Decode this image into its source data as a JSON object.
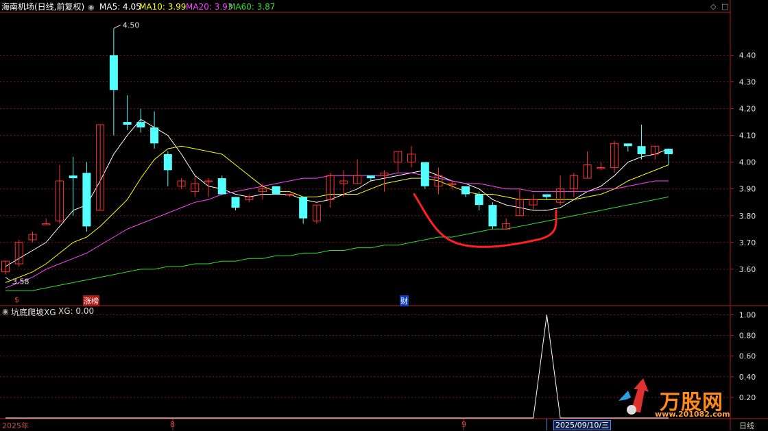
{
  "header": {
    "stock_title": "海南机场(日线,前复权)",
    "ma": [
      {
        "label": "MA5: 4.05",
        "color": "#ffffff"
      },
      {
        "label": "MA10: 3.99",
        "color": "#ffff00"
      },
      {
        "label": "MA20: 3.93",
        "color": "#ff44ff"
      },
      {
        "label": "MA60: 3.87",
        "color": "#33dd33"
      }
    ],
    "settings_icon": "chevron-down-icon",
    "window_controls": [
      "◇",
      "□"
    ]
  },
  "indicator": {
    "title": "坑底爬坡XG",
    "value_label": "XG: 0.00",
    "y_ticks": [
      "1.00",
      "0.80",
      "0.60",
      "0.40",
      "0.20"
    ]
  },
  "footer": {
    "period_labels": [
      "2025年",
      "8",
      "9"
    ],
    "selected_date": "2025/09/10/三",
    "timeframe": "日线"
  },
  "event_markers": [
    {
      "label": "$",
      "color": "#e04040"
    },
    {
      "label": "涨榜",
      "color": "#ffffff",
      "bg": "#b01818"
    },
    {
      "label": "财",
      "color": "#ffffff",
      "bg": "#1040c0"
    }
  ],
  "watermark": {
    "brand": "万股网",
    "url": "www.201082.com"
  },
  "chart_data": {
    "type": "candlestick",
    "price_axis": {
      "ticks": [
        "4.40",
        "4.30",
        "4.20",
        "4.10",
        "4.00",
        "3.90",
        "3.80",
        "3.70",
        "3.60"
      ],
      "ylim": [
        3.51,
        4.56
      ]
    },
    "annotations": {
      "high": "4.50",
      "low": "3.58"
    },
    "up_color": "#ff3232",
    "down_color": "#54ffff",
    "candles": [
      [
        3.59,
        3.63,
        3.63,
        3.58
      ],
      [
        3.62,
        3.7,
        3.71,
        3.61
      ],
      [
        3.71,
        3.73,
        3.74,
        3.7
      ],
      [
        3.77,
        3.77,
        3.79,
        3.77
      ],
      [
        3.78,
        3.93,
        3.99,
        3.77
      ],
      [
        3.95,
        3.94,
        4.02,
        3.8
      ],
      [
        3.96,
        3.76,
        4.0,
        3.74
      ],
      [
        3.82,
        4.14,
        4.14,
        3.82
      ],
      [
        4.4,
        4.27,
        4.5,
        4.1
      ],
      [
        4.15,
        4.14,
        4.25,
        4.12
      ],
      [
        4.15,
        4.13,
        4.2,
        4.11
      ],
      [
        4.13,
        4.07,
        4.19,
        4.05
      ],
      [
        4.03,
        3.97,
        4.04,
        3.91
      ],
      [
        3.91,
        3.93,
        3.94,
        3.9
      ],
      [
        3.89,
        3.92,
        3.95,
        3.87
      ],
      [
        3.93,
        3.93,
        3.94,
        3.87
      ],
      [
        3.94,
        3.88,
        3.95,
        3.88
      ],
      [
        3.87,
        3.83,
        3.87,
        3.82
      ],
      [
        3.86,
        3.87,
        3.88,
        3.85
      ],
      [
        3.89,
        3.9,
        3.92,
        3.86
      ],
      [
        3.91,
        3.88,
        3.91,
        3.88
      ],
      [
        3.88,
        3.88,
        3.88,
        3.87
      ],
      [
        3.87,
        3.79,
        3.87,
        3.77
      ],
      [
        3.78,
        3.84,
        3.84,
        3.77
      ],
      [
        3.86,
        3.95,
        3.96,
        3.83
      ],
      [
        3.92,
        3.93,
        3.97,
        3.87
      ],
      [
        3.92,
        3.95,
        4.01,
        3.92
      ],
      [
        3.95,
        3.94,
        3.95,
        3.93
      ],
      [
        3.95,
        3.96,
        3.97,
        3.89
      ],
      [
        4.0,
        4.04,
        4.04,
        3.96
      ],
      [
        4.0,
        4.03,
        4.06,
        3.98
      ],
      [
        4.0,
        3.91,
        4.0,
        3.9
      ],
      [
        3.91,
        3.95,
        3.98,
        3.88
      ],
      [
        3.92,
        3.92,
        3.93,
        3.9
      ],
      [
        3.91,
        3.88,
        3.91,
        3.87
      ],
      [
        3.88,
        3.84,
        3.89,
        3.82
      ],
      [
        3.84,
        3.76,
        3.85,
        3.75
      ],
      [
        3.75,
        3.77,
        3.79,
        3.75
      ],
      [
        3.8,
        3.86,
        3.9,
        3.8
      ],
      [
        3.84,
        3.86,
        3.88,
        3.82
      ],
      [
        3.88,
        3.87,
        3.88,
        3.86
      ],
      [
        3.85,
        3.9,
        3.95,
        3.84
      ],
      [
        3.9,
        3.95,
        3.96,
        3.87
      ],
      [
        3.94,
        3.99,
        4.04,
        3.94
      ],
      [
        3.98,
        3.98,
        4.0,
        3.97
      ],
      [
        3.98,
        4.07,
        4.08,
        3.96
      ],
      [
        4.07,
        4.06,
        4.07,
        4.04
      ],
      [
        4.06,
        4.03,
        4.14,
        4.01
      ],
      [
        4.03,
        4.06,
        4.06,
        4.01
      ],
      [
        4.05,
        4.03,
        4.05,
        3.99
      ]
    ],
    "ma_series": [
      {
        "name": "MA5",
        "color": "#ffffff",
        "values": [
          3.61,
          3.64,
          3.67,
          3.7,
          3.76,
          3.82,
          3.84,
          3.93,
          4.03,
          4.1,
          4.16,
          4.13,
          4.1,
          4.03,
          3.95,
          3.91,
          3.9,
          3.88,
          3.87,
          3.88,
          3.88,
          3.88,
          3.86,
          3.85,
          3.86,
          3.88,
          3.9,
          3.93,
          3.94,
          3.95,
          3.96,
          3.97,
          3.95,
          3.93,
          3.92,
          3.9,
          3.86,
          3.84,
          3.83,
          3.82,
          3.82,
          3.83,
          3.86,
          3.89,
          3.91,
          3.95,
          4.0,
          4.02,
          4.03,
          4.05
        ]
      },
      {
        "name": "MA10",
        "color": "#ffff00",
        "values": [
          3.55,
          3.57,
          3.59,
          3.62,
          3.66,
          3.7,
          3.72,
          3.76,
          3.81,
          3.86,
          3.94,
          4.01,
          4.05,
          4.06,
          4.05,
          4.04,
          4.03,
          3.99,
          3.95,
          3.91,
          3.89,
          3.89,
          3.87,
          3.87,
          3.88,
          3.88,
          3.88,
          3.9,
          3.92,
          3.93,
          3.94,
          3.94,
          3.93,
          3.91,
          3.89,
          3.88,
          3.88,
          3.87,
          3.86,
          3.86,
          3.86,
          3.86,
          3.86,
          3.87,
          3.88,
          3.9,
          3.93,
          3.95,
          3.97,
          3.99
        ]
      },
      {
        "name": "MA20",
        "color": "#ff44ff",
        "values": [
          3.53,
          3.55,
          3.57,
          3.6,
          3.62,
          3.64,
          3.66,
          3.69,
          3.72,
          3.75,
          3.77,
          3.79,
          3.81,
          3.83,
          3.85,
          3.86,
          3.88,
          3.89,
          3.9,
          3.91,
          3.92,
          3.93,
          3.94,
          3.94,
          3.95,
          3.95,
          3.95,
          3.95,
          3.95,
          3.96,
          3.96,
          3.95,
          3.94,
          3.93,
          3.92,
          3.92,
          3.91,
          3.9,
          3.9,
          3.89,
          3.89,
          3.89,
          3.89,
          3.89,
          3.9,
          3.9,
          3.91,
          3.92,
          3.93,
          3.93
        ]
      },
      {
        "name": "MA60",
        "color": "#33dd33",
        "values": [
          3.52,
          3.52,
          3.52,
          3.53,
          3.54,
          3.55,
          3.56,
          3.57,
          3.58,
          3.59,
          3.6,
          3.6,
          3.61,
          3.61,
          3.62,
          3.62,
          3.63,
          3.63,
          3.64,
          3.64,
          3.65,
          3.65,
          3.66,
          3.66,
          3.67,
          3.67,
          3.68,
          3.68,
          3.69,
          3.69,
          3.7,
          3.71,
          3.72,
          3.72,
          3.73,
          3.74,
          3.75,
          3.75,
          3.76,
          3.77,
          3.78,
          3.79,
          3.8,
          3.81,
          3.82,
          3.83,
          3.84,
          3.85,
          3.86,
          3.87
        ]
      }
    ],
    "indicator_series": {
      "name": "XG",
      "ylim": [
        0,
        1.05
      ],
      "values": [
        0,
        0,
        0,
        0,
        0,
        0,
        0,
        0,
        0,
        0,
        0,
        0,
        0,
        0,
        0,
        0,
        0,
        0,
        0,
        0,
        0,
        0,
        0,
        0,
        0,
        0,
        0,
        0,
        0,
        0,
        0,
        0,
        0,
        0,
        0,
        0,
        0,
        0,
        0,
        0,
        1,
        0,
        0,
        0,
        0,
        0,
        0,
        0,
        0,
        0
      ]
    },
    "hand_drawn_curve": {
      "color": "#ff2020",
      "shape": "U"
    }
  }
}
